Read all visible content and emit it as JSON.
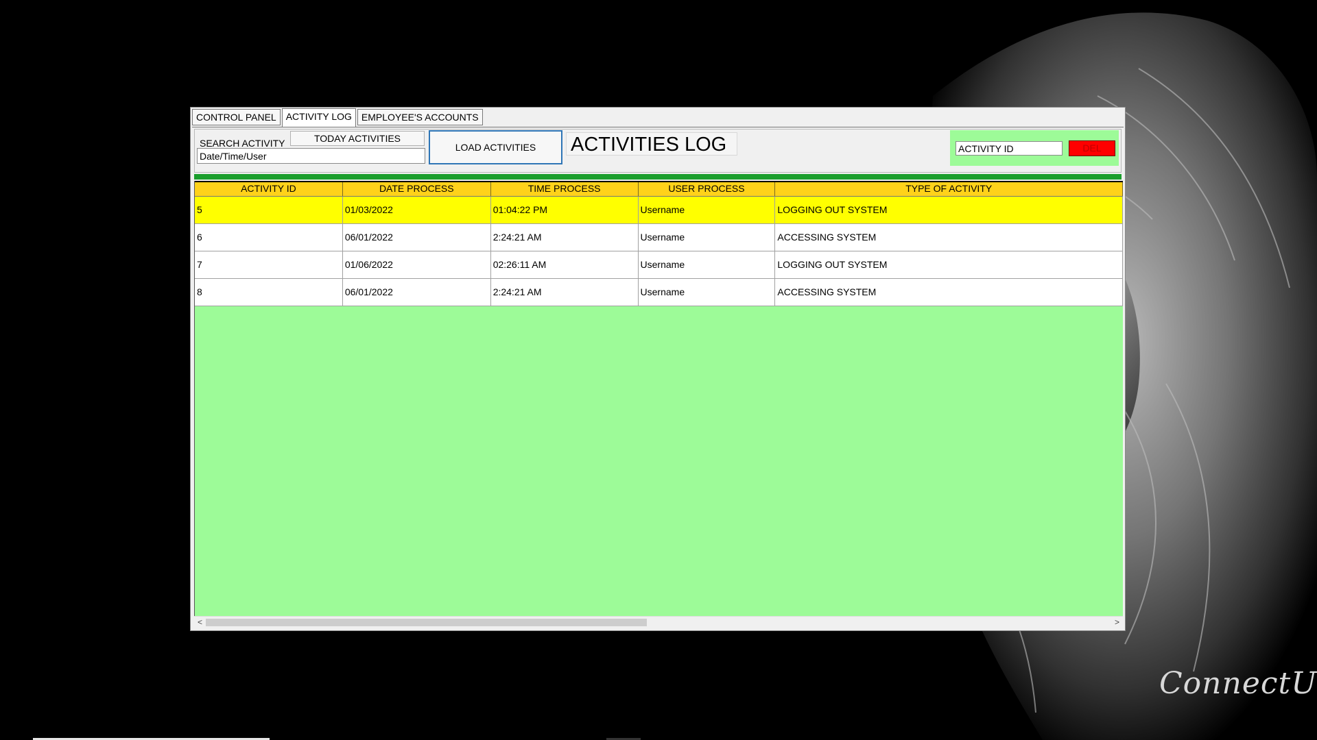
{
  "tabs": [
    {
      "label": "CONTROL PANEL"
    },
    {
      "label": "ACTIVITY LOG"
    },
    {
      "label": "EMPLOYEE'S ACCOUNTS"
    }
  ],
  "toolbar": {
    "search_label": "SEARCH ACTIVITY",
    "today_button": "TODAY ACTIVITIES",
    "search_placeholder": "Date/Time/User",
    "load_button": "LOAD ACTIVITIES",
    "page_title": "ACTIVITIES LOG",
    "activity_id_value": "ACTIVITY ID",
    "delete_button": "DEL"
  },
  "table": {
    "columns": [
      "ACTIVITY ID",
      "DATE PROCESS",
      "TIME PROCESS",
      "USER PROCESS",
      "TYPE OF ACTIVITY"
    ],
    "rows": [
      {
        "id": "5",
        "date": "01/03/2022",
        "time": "01:04:22 PM",
        "user": "Username",
        "type": "LOGGING OUT SYSTEM",
        "selected": true
      },
      {
        "id": "6",
        "date": "06/01/2022",
        "time": "2:24:21 AM",
        "user": "Username",
        "type": "ACCESSING SYSTEM",
        "selected": false
      },
      {
        "id": "7",
        "date": "01/06/2022",
        "time": "02:26:11 AM",
        "user": "Username",
        "type": "LOGGING OUT SYSTEM",
        "selected": false
      },
      {
        "id": "8",
        "date": "06/01/2022",
        "time": "2:24:21 AM",
        "user": "Username",
        "type": "ACCESSING SYSTEM",
        "selected": false
      }
    ]
  },
  "scrollbar": {
    "left_icon": "chevron-left-icon",
    "right_icon": "chevron-right-icon",
    "left_glyph": "<",
    "right_glyph": ">"
  },
  "brand": "ConnectUs",
  "colors": {
    "header_bg": "#ffd21a",
    "selected_row": "#ffff00",
    "grid_bg": "#9dfb98",
    "separator": "#1a9e2c",
    "delete_button": "#ff0000",
    "load_border": "#2e75b6"
  }
}
